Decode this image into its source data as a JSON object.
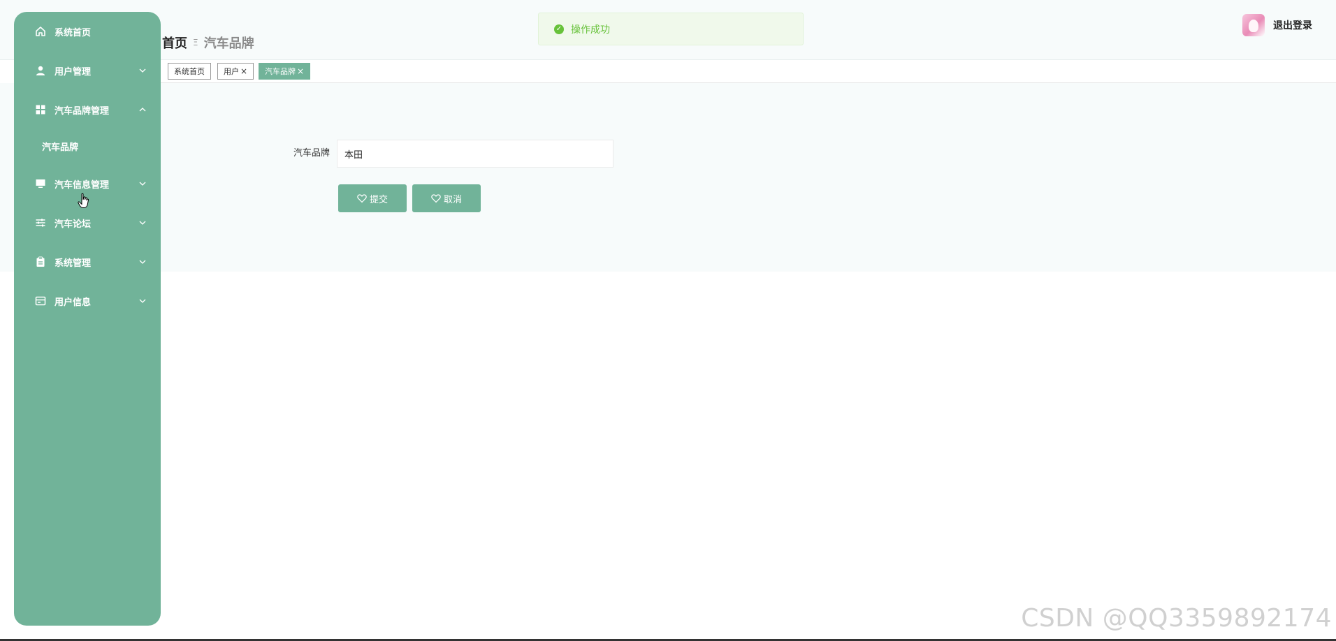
{
  "breadcrumb": {
    "home": "首页",
    "separator": "Ξ",
    "current": "汽车品牌"
  },
  "toast": {
    "message": "操作成功",
    "color": "#67c23a"
  },
  "user": {
    "logout_label": "退出登录"
  },
  "theme": {
    "accent": "#71b399"
  },
  "sidebar": {
    "items": [
      {
        "label": "系统首页",
        "icon": "home-icon"
      },
      {
        "label": "用户管理",
        "icon": "user-icon"
      },
      {
        "label": "汽车品牌管理",
        "icon": "grid-icon",
        "expanded": true
      },
      {
        "label": "汽车品牌"
      },
      {
        "label": "汽车信息管理",
        "icon": "monitor-icon"
      },
      {
        "label": "汽车论坛",
        "icon": "sliders-icon"
      },
      {
        "label": "系统管理",
        "icon": "clipboard-icon"
      },
      {
        "label": "用户信息",
        "icon": "card-icon"
      }
    ]
  },
  "tabs": [
    {
      "label": "系统首页",
      "closable": false,
      "active": false
    },
    {
      "label": "用户",
      "closable": true,
      "active": false
    },
    {
      "label": "汽车品牌",
      "closable": true,
      "active": true
    }
  ],
  "form": {
    "brand_label": "汽车品牌",
    "brand_value": "本田",
    "submit_label": "提交",
    "cancel_label": "取消"
  },
  "watermark": "CSDN @QQ3359892174"
}
